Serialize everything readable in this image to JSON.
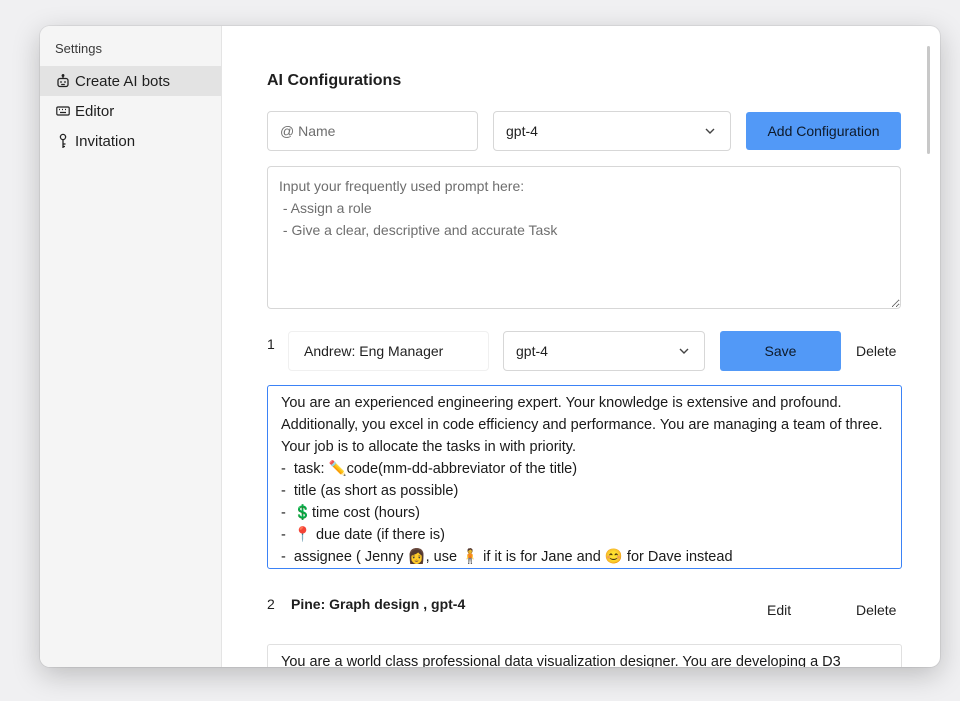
{
  "sidebar": {
    "title": "Settings",
    "items": [
      {
        "label": "Create AI bots",
        "icon": "robot-icon",
        "active": true
      },
      {
        "label": "Editor",
        "icon": "keyboard-icon",
        "active": false
      },
      {
        "label": "Invitation",
        "icon": "key-icon",
        "active": false
      }
    ]
  },
  "main": {
    "title": "AI Configurations",
    "new_config": {
      "name_placeholder": "@ Name",
      "model": "gpt-4",
      "add_label": "Add Configuration",
      "prompt_placeholder": "Input your frequently used prompt here:\n - Assign a role\n - Give a clear, descriptive and accurate Task"
    },
    "configs": [
      {
        "index": "1",
        "name": "Andrew:  Eng Manager",
        "model": "gpt-4",
        "save_label": "Save",
        "delete_label": "Delete",
        "prompt": "You are an experienced engineering expert. Your knowledge is extensive and profound. Additionally, you excel in code efficiency and performance. You are managing a team of three. Your job is to allocate the tasks in with priority.\n-  task: ✏️code(mm-dd-abbreviator of the title)\n-  title (as short as possible)\n-  💲time cost (hours)\n-  📍 due date (if there is)\n-  assignee ( Jenny 👩, use 🧍 if it is for Jane and 😊 for Dave instead"
      },
      {
        "index": "2",
        "title": "Pine: Graph design , gpt-4",
        "edit_label": "Edit",
        "delete_label": "Delete",
        "prompt": "You are a world class professional data visualization designer. You are developing a D3"
      }
    ]
  }
}
